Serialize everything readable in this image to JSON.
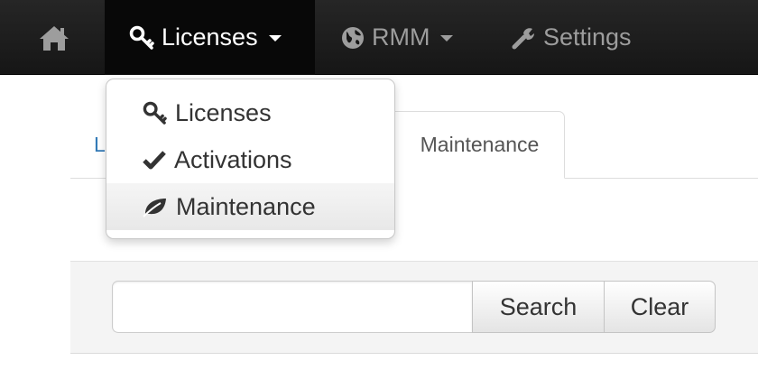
{
  "navbar": {
    "home_icon": "home-icon",
    "licenses": {
      "label": "Licenses",
      "icon": "key-icon"
    },
    "rmm": {
      "label": "RMM",
      "icon": "globe-icon"
    },
    "settings": {
      "label": "Settings",
      "icon": "wrench-icon"
    }
  },
  "dropdown": {
    "items": [
      {
        "label": "Licenses",
        "icon": "key-icon"
      },
      {
        "label": "Activations",
        "icon": "check-icon"
      },
      {
        "label": "Maintenance",
        "icon": "leaf-icon"
      }
    ]
  },
  "tabs": {
    "left_partial": "L",
    "active": "Maintenance"
  },
  "search": {
    "value": "",
    "search_label": "Search",
    "clear_label": "Clear"
  },
  "colors": {
    "navbar_bg": "#222222",
    "nav_text": "#9d9d9d",
    "link_blue": "#337ab7"
  }
}
